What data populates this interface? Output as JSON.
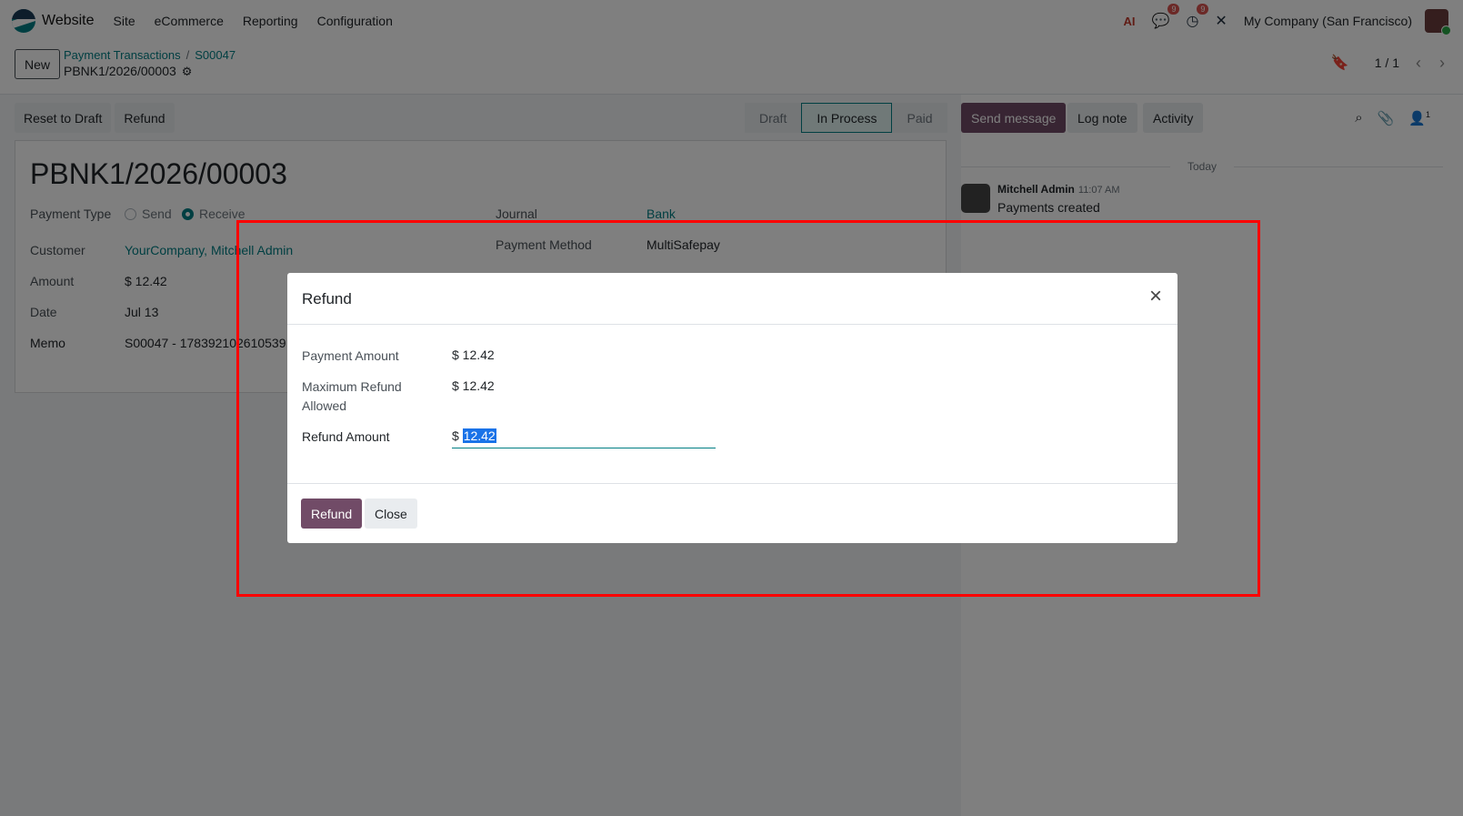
{
  "navbar": {
    "app_name": "Website",
    "menus": [
      "Site",
      "eCommerce",
      "Reporting",
      "Configuration"
    ],
    "ai_icon": "AI",
    "messages_count": "9",
    "activities_count": "9",
    "company": "My Company (San Francisco)"
  },
  "control_panel": {
    "new_label": "New",
    "breadcrumb": [
      "Payment Transactions",
      "S00047"
    ],
    "record_name": "PBNK1/2026/00003",
    "pager_value": "1 / 1"
  },
  "form": {
    "buttons": [
      "Reset to Draft",
      "Refund"
    ],
    "status_steps": [
      "Draft",
      "In Process",
      "Paid"
    ],
    "active_step": "In Process",
    "title": "PBNK1/2026/00003",
    "payment_type_label": "Payment Type",
    "payment_type_options": [
      "Send",
      "Receive"
    ],
    "payment_type_selected": "Receive",
    "customer_label": "Customer",
    "customer_value": "YourCompany, Mitchell Admin",
    "amount_label": "Amount",
    "amount_value": "$ 12.42",
    "date_label": "Date",
    "date_value": "Jul 13",
    "memo_label": "Memo",
    "memo_value": "S00047 - 178392102610539",
    "journal_label": "Journal",
    "journal_value": "Bank",
    "payment_method_label": "Payment Method",
    "payment_method_value": "MultiSafepay"
  },
  "chatter": {
    "send_message": "Send message",
    "log_note": "Log note",
    "activity": "Activity",
    "followers_count": "1",
    "date_separator": "Today",
    "message": {
      "author": "Mitchell Admin",
      "time": "11:07 AM",
      "body": "Payments created"
    }
  },
  "dialog": {
    "title": "Refund",
    "payment_amount_label": "Payment Amount",
    "payment_amount_value": "$ 12.42",
    "max_refund_label_1": "Maximum Refund",
    "max_refund_label_2": "Allowed",
    "max_refund_value": "$ 12.42",
    "refund_amount_label": "Refund Amount",
    "currency_symbol": "$",
    "refund_amount_value": "12.42",
    "refund_button": "Refund",
    "close_button": "Close"
  },
  "colors": {
    "primary": "#714b67",
    "link": "#017e84",
    "highlight": "#ff0000"
  }
}
